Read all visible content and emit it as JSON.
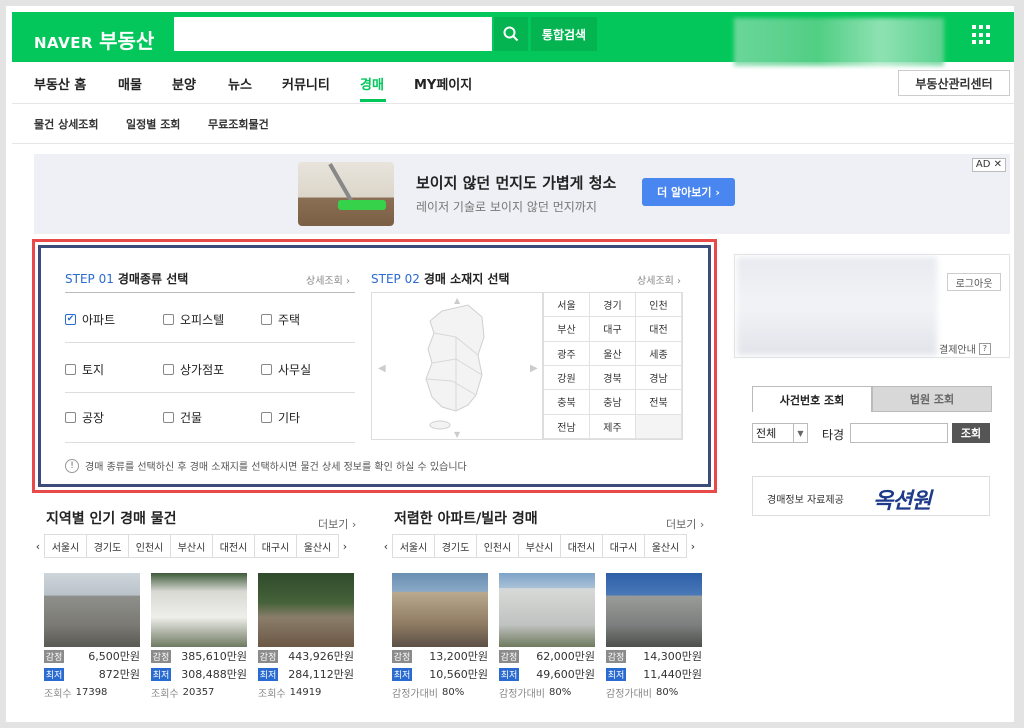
{
  "header": {
    "logo_naver": "NAVER",
    "logo_service": "부동산",
    "search_placeholder": "",
    "integrated_search": "통합검색"
  },
  "nav": {
    "items": [
      "부동산 홈",
      "매물",
      "분양",
      "뉴스",
      "커뮤니티",
      "경매",
      "MY페이지"
    ],
    "active": "경매",
    "mgmt_button": "부동산관리센터"
  },
  "subnav": {
    "items": [
      "물건 상세조회",
      "일정별 조회",
      "무료조회물건"
    ]
  },
  "ad": {
    "title": "보이지 않던 먼지도 가볍게 청소",
    "subtitle": "레이저 기술로 보이지 않던 먼지까지",
    "cta": "더 알아보기 ›",
    "tag": "AD ✕"
  },
  "step1": {
    "num": "STEP 01",
    "label": "경매종류 선택",
    "detail": "상세조회 ›",
    "options": [
      {
        "label": "아파트",
        "checked": true
      },
      {
        "label": "오피스텔",
        "checked": false
      },
      {
        "label": "주택",
        "checked": false
      },
      {
        "label": "토지",
        "checked": false
      },
      {
        "label": "상가점포",
        "checked": false
      },
      {
        "label": "사무실",
        "checked": false
      },
      {
        "label": "공장",
        "checked": false
      },
      {
        "label": "건물",
        "checked": false
      },
      {
        "label": "기타",
        "checked": false
      }
    ]
  },
  "step2": {
    "num": "STEP 02",
    "label": "경매 소재지 선택",
    "detail": "상세조회 ›",
    "regions": [
      "서울",
      "경기",
      "인천",
      "부산",
      "대구",
      "대전",
      "광주",
      "울산",
      "세종",
      "강원",
      "경북",
      "경남",
      "충북",
      "충남",
      "전북",
      "전남",
      "제주",
      ""
    ]
  },
  "notice": "경매 종류를 선택하신 후 경매 소재지를 선택하시면 물건 상세 정보를 확인 하실 수 있습니다",
  "account": {
    "logout": "로그아웃",
    "pay_info": "결제안내",
    "help": "?"
  },
  "case_search": {
    "tab_case": "사건번호 조회",
    "tab_court": "법원 조회",
    "select_value": "전체",
    "label_tagyeong": "타경",
    "button": "조회"
  },
  "provider": {
    "text": "경매정보 자료제공",
    "brand": "옥션원"
  },
  "popular": {
    "title": "지역별 인기 경매 물건",
    "more": "더보기 ›",
    "cities": [
      "서울시",
      "경기도",
      "인천시",
      "부산시",
      "대전시",
      "대구시",
      "울산시"
    ],
    "items": [
      {
        "appraisal": "6,500만원",
        "minimum": "872만원",
        "views_label": "조회수",
        "views": "17398"
      },
      {
        "appraisal": "385,610만원",
        "minimum": "308,488만원",
        "views_label": "조회수",
        "views": "20357"
      },
      {
        "appraisal": "443,926만원",
        "minimum": "284,112만원",
        "views_label": "조회수",
        "views": "14919"
      }
    ]
  },
  "cheap": {
    "title": "저렴한 아파트/빌라 경매",
    "more": "더보기 ›",
    "cities": [
      "서울시",
      "경기도",
      "인천시",
      "부산시",
      "대전시",
      "대구시",
      "울산시"
    ],
    "items": [
      {
        "appraisal": "13,200만원",
        "minimum": "10,560만원",
        "ratio_label": "감정가대비",
        "ratio": "80%"
      },
      {
        "appraisal": "62,000만원",
        "minimum": "49,600만원",
        "ratio_label": "감정가대비",
        "ratio": "80%"
      },
      {
        "appraisal": "14,300만원",
        "minimum": "11,440만원",
        "ratio_label": "감정가대비",
        "ratio": "80%"
      }
    ]
  },
  "labels": {
    "appraisal": "감정",
    "minimum": "최저"
  },
  "colors": {
    "brand": "#03c75a",
    "accent_blue": "#2a6bd1",
    "highlight_red": "#e84a4a",
    "box_border": "#3b4b7a"
  }
}
